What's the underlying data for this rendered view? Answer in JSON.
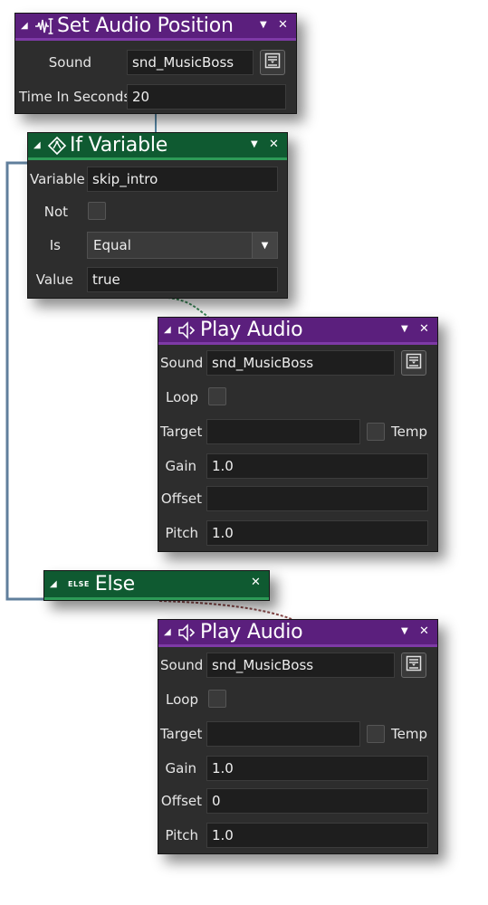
{
  "nodes": {
    "set_audio_position": {
      "title": "Set Audio Position",
      "fields": {
        "sound": {
          "label": "Sound",
          "value": "snd_MusicBoss"
        },
        "time": {
          "label": "Time In Seconds",
          "value": "20"
        }
      }
    },
    "if_variable": {
      "title": "If Variable",
      "fields": {
        "variable": {
          "label": "Variable",
          "value": "skip_intro"
        },
        "not": {
          "label": "Not",
          "checked": false
        },
        "is": {
          "label": "Is",
          "selected": "Equal"
        },
        "value": {
          "label": "Value",
          "value": "true"
        }
      }
    },
    "play_audio_1": {
      "title": "Play Audio",
      "fields": {
        "sound": {
          "label": "Sound",
          "value": "snd_MusicBoss"
        },
        "loop": {
          "label": "Loop",
          "checked": false
        },
        "target": {
          "label": "Target",
          "value": ""
        },
        "temp": {
          "label": "Temp",
          "checked": false
        },
        "gain": {
          "label": "Gain",
          "value": "1.0"
        },
        "offset": {
          "label": "Offset",
          "value": ""
        },
        "pitch": {
          "label": "Pitch",
          "value": "1.0"
        }
      }
    },
    "else": {
      "badge": "ELSE",
      "title": "Else"
    },
    "play_audio_2": {
      "title": "Play Audio",
      "fields": {
        "sound": {
          "label": "Sound",
          "value": "snd_MusicBoss"
        },
        "loop": {
          "label": "Loop",
          "checked": false
        },
        "target": {
          "label": "Target",
          "value": ""
        },
        "temp": {
          "label": "Temp",
          "checked": false
        },
        "gain": {
          "label": "Gain",
          "value": "1.0"
        },
        "offset": {
          "label": "Offset",
          "value": "0"
        },
        "pitch": {
          "label": "Pitch",
          "value": "1.0"
        }
      }
    }
  },
  "icons": {
    "collapse": "collapse-triangle-icon",
    "menu": "menu-triangle-icon",
    "close": "close-icon",
    "set_audio_position": "audio-waveform-icon",
    "if_variable": "variable-condition-icon",
    "play_audio": "speaker-icon",
    "asset_browser": "asset-browser-icon"
  },
  "colors": {
    "action_header": "#5b1f7d",
    "condition_header": "#0f5a31",
    "node_body": "#2d2d2d",
    "field": "#1e1e1e"
  }
}
